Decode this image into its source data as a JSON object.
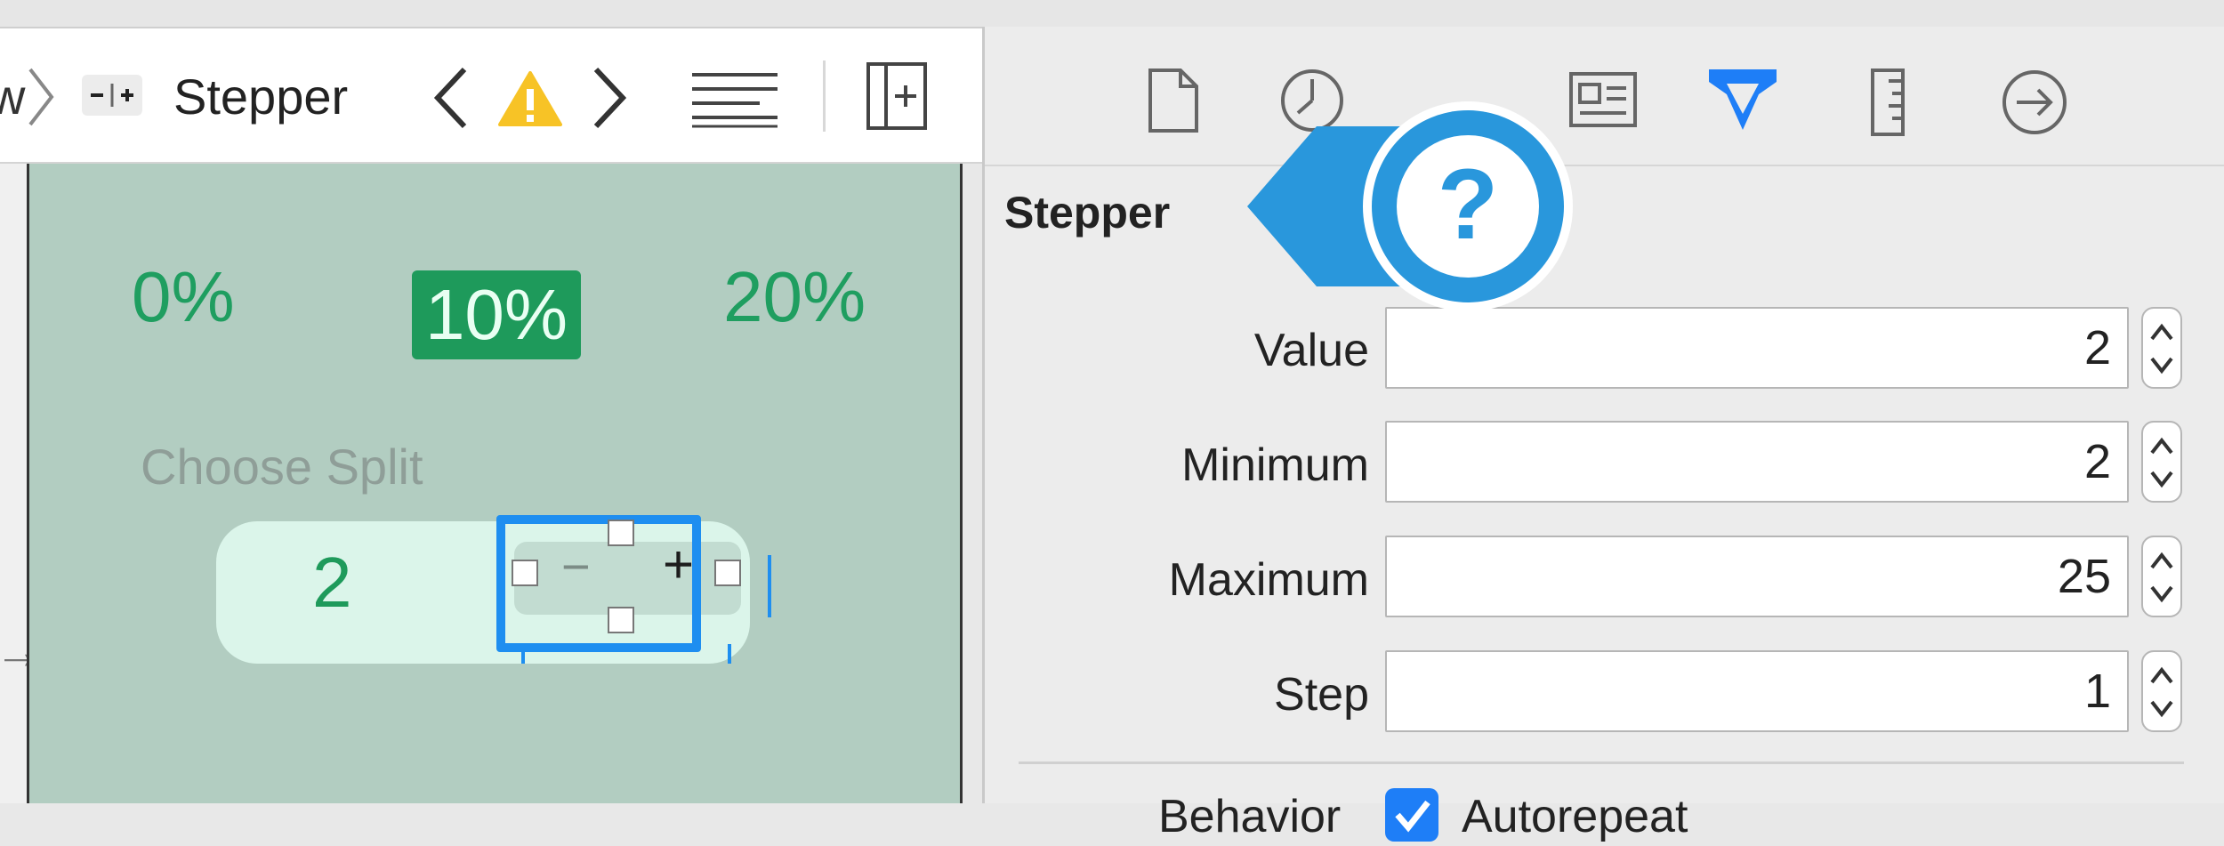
{
  "breadcrumb": {
    "prev_item": "w",
    "current_item": "Stepper"
  },
  "canvas": {
    "percent_options": [
      "0%",
      "10%",
      "20%"
    ],
    "selected_percent": "10%",
    "choose_split_label": "Choose Split",
    "split_value": "2",
    "stepper_minus": "−",
    "stepper_plus": "+"
  },
  "inspector": {
    "section_title": "Stepper",
    "rows": [
      {
        "label": "Value",
        "value": "2"
      },
      {
        "label": "Minimum",
        "value": "2"
      },
      {
        "label": "Maximum",
        "value": "25"
      },
      {
        "label": "Step",
        "value": "1"
      }
    ],
    "behavior_label": "Behavior",
    "autorepeat_label": "Autorepeat",
    "autorepeat_checked": true,
    "active_tab_icon": "attributes-inspector-icon"
  },
  "help_callout": {
    "symbol": "?"
  },
  "colors": {
    "accent_blue": "#1e8ef0",
    "help_blue": "#2997dc",
    "canvas_green": "#b2cdc1",
    "text_green": "#1f9e60",
    "warning_yellow": "#f7c326"
  }
}
